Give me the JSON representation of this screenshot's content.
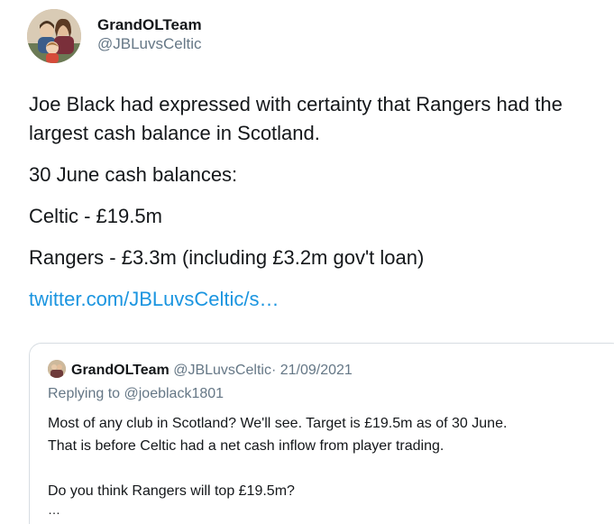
{
  "tweet": {
    "author": {
      "display_name": "GrandOLTeam",
      "handle": "@JBLuvsCeltic"
    },
    "paragraphs": [
      "Joe Black had expressed with certainty that Rangers had the largest cash balance in Scotland.",
      "30 June cash balances:",
      "Celtic - £19.5m",
      "Rangers - £3.3m (including £3.2m gov't loan)"
    ],
    "link_text": "twitter.com/JBLuvsCeltic/s…"
  },
  "quoted_tweet": {
    "display_name": "GrandOLTeam",
    "handle": "@JBLuvsCeltic",
    "separator": "·",
    "date": "21/09/2021",
    "replying_to": "Replying to @joeblack1801",
    "lines": [
      "Most of any club in Scotland? We'll see. Target is £19.5m as of 30 June.",
      "That is before Celtic had a net cash inflow from player trading."
    ],
    "question": "Do you think Rangers will top £19.5m?",
    "ellipsis": "…"
  },
  "colors": {
    "link": "#1b95e0",
    "secondary_text": "#657786",
    "primary_text": "#14171a",
    "border": "#d7dde2"
  },
  "icons": {
    "avatar": "profile-photo-icon",
    "quote_avatar": "profile-photo-icon"
  }
}
